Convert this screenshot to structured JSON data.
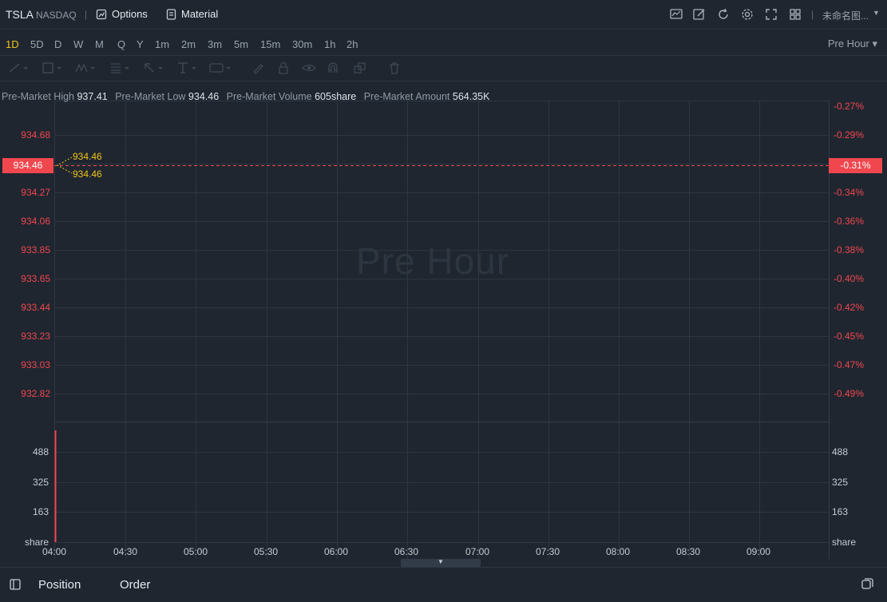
{
  "header": {
    "symbol": "TSLA",
    "exchange": "NASDAQ",
    "separator": "|",
    "options_label": "Options",
    "material_label": "Material",
    "template_name": "未命名图...",
    "icons": [
      "indicator-icon",
      "draw-icon",
      "refresh-icon",
      "settings-icon",
      "fullscreen-icon",
      "layout-icon"
    ]
  },
  "timeframes": [
    "1D",
    "5D",
    "D",
    "W",
    "M",
    "Q",
    "Y",
    "1m",
    "2m",
    "3m",
    "5m",
    "15m",
    "30m",
    "1h",
    "2h"
  ],
  "active_timeframe": "1D",
  "session_select": "Pre Hour ▾",
  "stats": {
    "high_label": "Pre-Market High",
    "high_value": "937.41",
    "low_label": "Pre-Market Low",
    "low_value": "934.46",
    "volume_label": "Pre-Market Volume",
    "volume_value": "605share",
    "amount_label": "Pre-Market Amount",
    "amount_value": "564.35K"
  },
  "watermark": "Pre Hour",
  "current": {
    "price": "934.46",
    "pct": "-0.31%"
  },
  "hl_labels": {
    "high": "934.46",
    "low": "934.46"
  },
  "price_axis": [
    "934.68",
    "934.46",
    "934.27",
    "934.06",
    "933.85",
    "933.65",
    "933.44",
    "933.23",
    "933.03",
    "932.82"
  ],
  "pct_axis": [
    "-0.27%",
    "-0.29%",
    "-0.31%",
    "-0.34%",
    "-0.36%",
    "-0.38%",
    "-0.40%",
    "-0.42%",
    "-0.45%",
    "-0.47%",
    "-0.49%"
  ],
  "volume_axis": {
    "ticks": [
      "488",
      "325",
      "163"
    ],
    "unit": "share"
  },
  "time_axis": [
    "04:00",
    "04:30",
    "05:00",
    "05:30",
    "06:00",
    "06:30",
    "07:00",
    "07:30",
    "08:00",
    "08:30",
    "09:00"
  ],
  "colors": {
    "accent": "#f0c419",
    "down": "#f0474e",
    "background": "#1f2630",
    "grid": "#2d3641"
  },
  "bottom": {
    "position_label": "Position",
    "order_label": "Order"
  }
}
